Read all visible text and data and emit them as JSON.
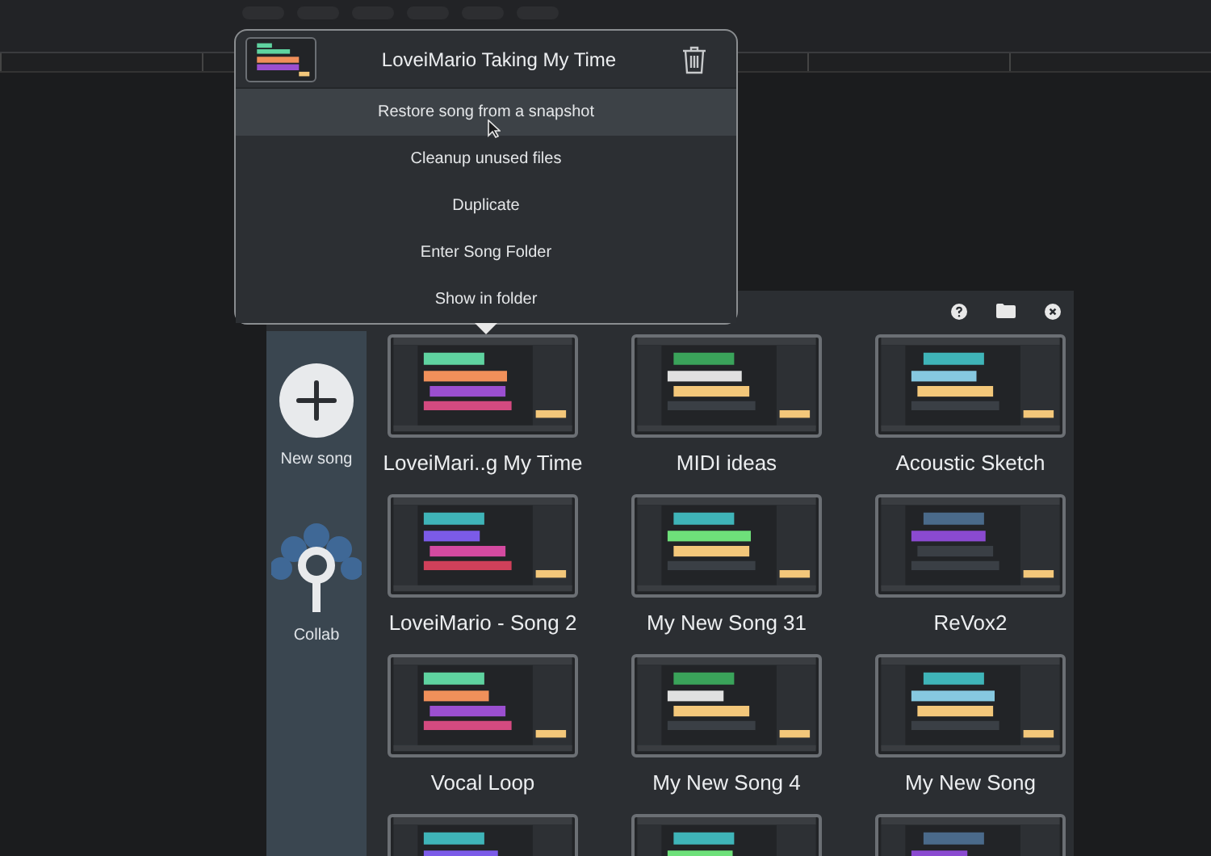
{
  "popup": {
    "title": "LoveiMario Taking My Time",
    "items": [
      {
        "label": "Restore song from a snapshot",
        "highlighted": true
      },
      {
        "label": "Cleanup unused files",
        "highlighted": false
      },
      {
        "label": "Duplicate",
        "highlighted": false
      },
      {
        "label": "Enter Song Folder",
        "highlighted": false
      },
      {
        "label": "Show in folder",
        "highlighted": false
      }
    ]
  },
  "sidebar": {
    "items": [
      {
        "kind": "new",
        "label": "New song"
      },
      {
        "kind": "collab",
        "label": "Collab"
      }
    ]
  },
  "songs": [
    {
      "kind": "song",
      "title": "LoveiMari..g My Time"
    },
    {
      "kind": "song",
      "title": "MIDI ideas"
    },
    {
      "kind": "song",
      "title": "Acoustic Sketch"
    },
    {
      "kind": "song",
      "title": "LoveiMario - Song 2"
    },
    {
      "kind": "song",
      "title": "My New Song 31"
    },
    {
      "kind": "song",
      "title": "ReVox2"
    },
    {
      "kind": "song",
      "title": "Vocal Loop"
    },
    {
      "kind": "song",
      "title": "My New Song 4"
    },
    {
      "kind": "song",
      "title": "My New Song"
    },
    {
      "kind": "picture"
    },
    {
      "kind": "picture"
    },
    {
      "kind": "picture"
    }
  ]
}
